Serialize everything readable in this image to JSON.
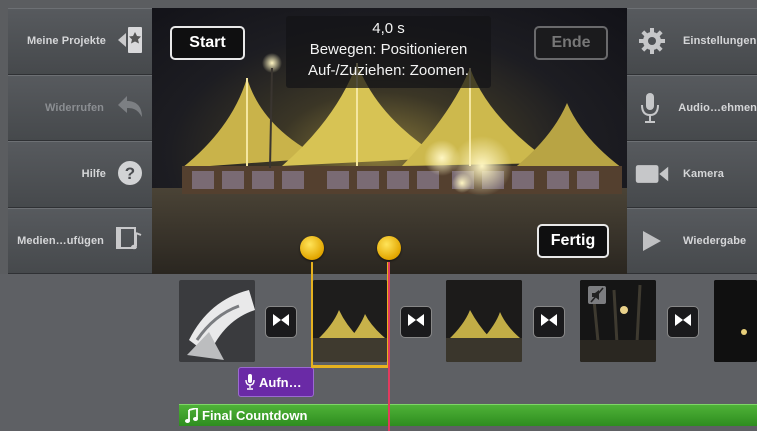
{
  "left_sidebar": {
    "items": [
      {
        "label": "Meine Projekte",
        "icon": "projects-star-icon"
      },
      {
        "label": "Widerrufen",
        "icon": "undo-arrow-icon"
      },
      {
        "label": "Hilfe",
        "icon": "help-question-icon"
      },
      {
        "label": "Medien…ufügen",
        "icon": "media-add-icon"
      }
    ]
  },
  "right_sidebar": {
    "items": [
      {
        "label": "Einstellungen",
        "icon": "gear-icon"
      },
      {
        "label": "Audio…ehmen",
        "icon": "microphone-icon"
      },
      {
        "label": "Kamera",
        "icon": "camera-icon"
      },
      {
        "label": "Wiedergabe",
        "icon": "play-icon"
      }
    ]
  },
  "preview": {
    "start_label": "Start",
    "end_label": "Ende",
    "done_label": "Fertig",
    "info": {
      "duration": "4,0 s",
      "move_hint": "Bewegen: Positionieren",
      "pinch_hint": "Auf-/Zuziehen: Zoomen."
    }
  },
  "timeline": {
    "audio_clip_label": "Aufn…",
    "music_track_label": "Final Countdown"
  },
  "colors": {
    "selection": "#e6b21f",
    "playhead": "#e23a5f",
    "audio_clip": "#6a2aa6",
    "music_track": "#3ea02b"
  }
}
